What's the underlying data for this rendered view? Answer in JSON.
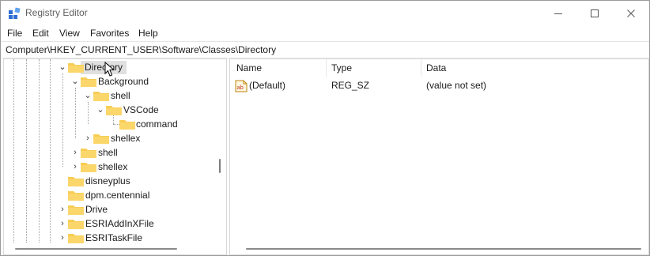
{
  "window": {
    "title": "Registry Editor"
  },
  "menu": [
    "File",
    "Edit",
    "View",
    "Favorites",
    "Help"
  ],
  "address": "Computer\\HKEY_CURRENT_USER\\Software\\Classes\\Directory",
  "tree": {
    "nodes": [
      {
        "label": "Directory",
        "expanded": true,
        "selected": true
      },
      {
        "label": "Background",
        "expanded": true
      },
      {
        "label": "shell",
        "expanded": true
      },
      {
        "label": "VSCode",
        "expanded": true
      },
      {
        "label": "command"
      },
      {
        "label": "shellex",
        "expanded": false
      },
      {
        "label": "shell",
        "expanded": false
      },
      {
        "label": "shellex",
        "expanded": false
      },
      {
        "label": "disneyplus"
      },
      {
        "label": "dpm.centennial"
      },
      {
        "label": "Drive",
        "expanded": false
      },
      {
        "label": "ESRIAddInXFile",
        "expanded": false
      },
      {
        "label": "ESRITaskFile",
        "expanded": false
      }
    ]
  },
  "list": {
    "columns": [
      "Name",
      "Type",
      "Data"
    ],
    "rows": [
      {
        "name": "(Default)",
        "type": "REG_SZ",
        "data": "(value not set)",
        "icon": "string-value-icon"
      }
    ]
  },
  "colors": {
    "folder": "#f7cd55",
    "folder_dark": "#e8b130",
    "selection": "#e0e0e0",
    "regedit_blue": "#2f6fd4"
  }
}
